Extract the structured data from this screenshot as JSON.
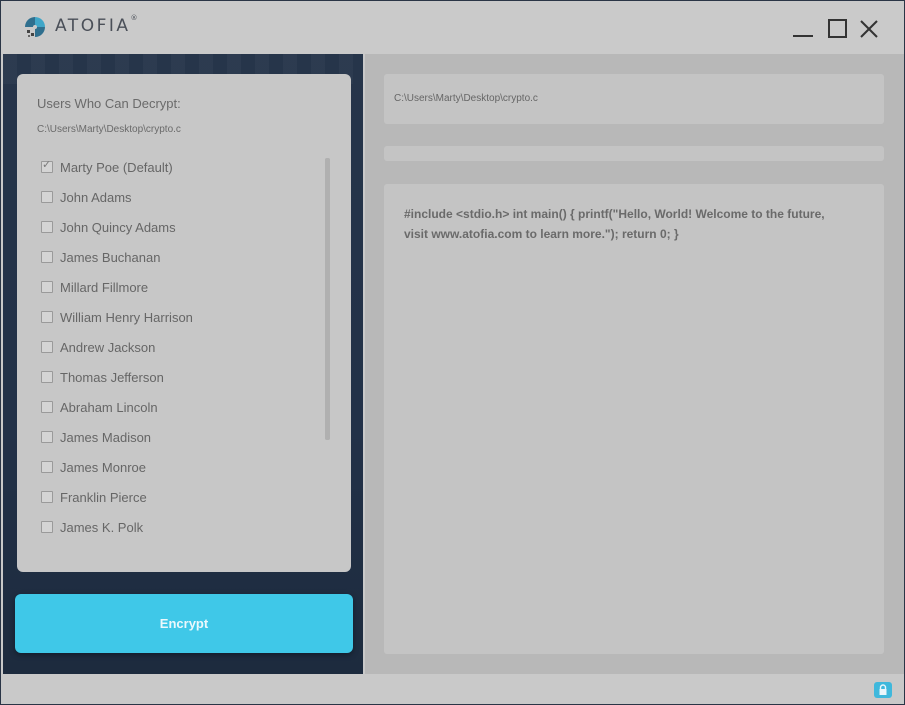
{
  "app": {
    "brand": "ATOFIA",
    "trademark": "®"
  },
  "window_controls": {
    "minimize": "minimize",
    "maximize": "maximize",
    "close": "close"
  },
  "users_panel": {
    "title": "Users Who Can Decrypt:",
    "file_path": "C:\\Users\\Marty\\Desktop\\crypto.c",
    "users": [
      {
        "name": "Marty Poe (Default)",
        "checked": true
      },
      {
        "name": "John Adams",
        "checked": false
      },
      {
        "name": "John Quincy Adams",
        "checked": false
      },
      {
        "name": "James Buchanan",
        "checked": false
      },
      {
        "name": "Millard Fillmore",
        "checked": false
      },
      {
        "name": "William Henry Harrison",
        "checked": false
      },
      {
        "name": "Andrew Jackson",
        "checked": false
      },
      {
        "name": "Thomas Jefferson",
        "checked": false
      },
      {
        "name": "Abraham Lincoln",
        "checked": false
      },
      {
        "name": "James Madison",
        "checked": false
      },
      {
        "name": "James Monroe",
        "checked": false
      },
      {
        "name": "Franklin Pierce",
        "checked": false
      },
      {
        "name": "James K. Polk",
        "checked": false
      }
    ]
  },
  "encrypt_button": {
    "label": "Encrypt"
  },
  "file_view": {
    "path": "C:\\Users\\Marty\\Desktop\\crypto.c",
    "content": "#include <stdio.h> int main() { printf(\"Hello, World! Welcome to the future, visit www.atofia.com to learn more.\"); return 0; }"
  },
  "colors": {
    "accent": "#3fc8e8",
    "dark_panel": "#26354a",
    "card": "#c7c7c7"
  },
  "icons": {
    "logo": "atofia-logo-icon",
    "status": "lock-icon"
  }
}
